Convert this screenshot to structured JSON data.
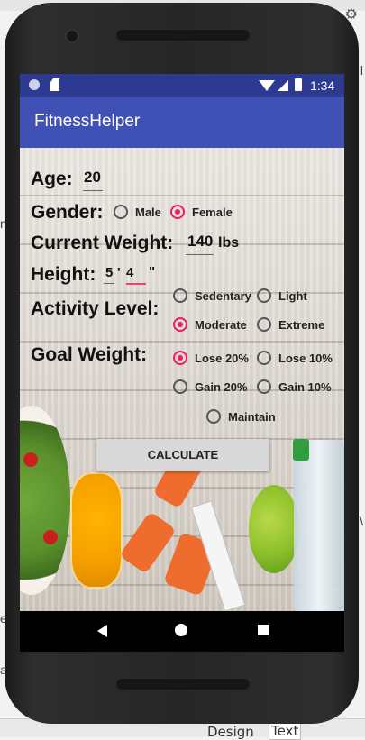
{
  "app": {
    "title": "FitnessHelper"
  },
  "status_bar": {
    "time": "1:34"
  },
  "form": {
    "age": {
      "label": "Age:",
      "value": "20"
    },
    "gender": {
      "label": "Gender:",
      "options": [
        "Male",
        "Female"
      ],
      "selected": "Female"
    },
    "current_weight": {
      "label": "Current Weight:",
      "value": "140",
      "unit": "lbs"
    },
    "height": {
      "label": "Height:",
      "feet": "5",
      "feet_mark": "'",
      "inches": "4",
      "inches_mark": "\""
    },
    "activity_level": {
      "label": "Activity Level:",
      "options": [
        "Sedentary",
        "Light",
        "Moderate",
        "Extreme"
      ],
      "selected": "Moderate"
    },
    "goal_weight": {
      "label": "Goal Weight:",
      "options": [
        "Lose 20%",
        "Lose 10%",
        "Gain 20%",
        "Gain 10%",
        "Maintain"
      ],
      "selected": "Lose 20%"
    }
  },
  "calculate_button": "CALCULATE",
  "ide": {
    "tab_design": "Design",
    "tab_text": "Text"
  },
  "colors": {
    "appbar": "#3f51b5",
    "statusbar": "#2c3a92",
    "accent": "#e91e63"
  }
}
